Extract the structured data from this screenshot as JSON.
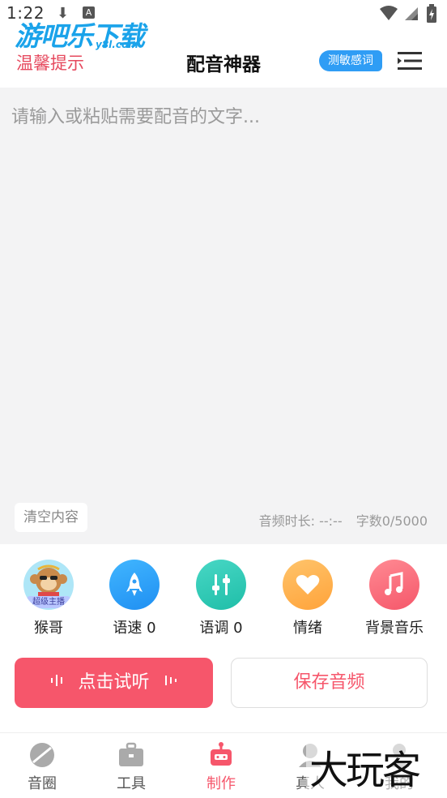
{
  "status_bar": {
    "time": "1:22"
  },
  "watermark": {
    "logo_text": "游吧乐下载",
    "logo_sub": "y8l.com",
    "corner_text": "大玩客"
  },
  "header": {
    "tips_label": "温馨提示",
    "title": "配音神器",
    "sensitive_button": "测敏感词"
  },
  "editor": {
    "placeholder": "请输入或粘贴需要配音的文字...",
    "clear_button": "清空内容",
    "duration_text": "音频时长: --:--",
    "char_count_text": "字数0/5000"
  },
  "tools": [
    {
      "label": "猴哥",
      "badge": "超级主播",
      "icon": "monkey-avatar"
    },
    {
      "label": "语速 0",
      "icon": "rocket-icon",
      "color": "#2f9df5"
    },
    {
      "label": "语调 0",
      "icon": "sliders-icon",
      "color": "#27c4ae"
    },
    {
      "label": "情绪",
      "icon": "heart-icon",
      "color": "#ffae45"
    },
    {
      "label": "背景音乐",
      "icon": "music-note-icon",
      "color": "#f6566b"
    }
  ],
  "actions": {
    "preview_label": "点击试听",
    "save_label": "保存音频"
  },
  "bottom_nav": [
    {
      "label": "音圈",
      "icon": "circle-icon"
    },
    {
      "label": "工具",
      "icon": "toolbox-icon"
    },
    {
      "label": "制作",
      "icon": "robot-icon",
      "active": true
    },
    {
      "label": "真人",
      "icon": "person-icon"
    },
    {
      "label": "我的",
      "icon": "profile-icon"
    }
  ],
  "colors": {
    "accent": "#f6566b",
    "blue": "#2f9df5",
    "editor_bg": "#f3f3f4"
  }
}
